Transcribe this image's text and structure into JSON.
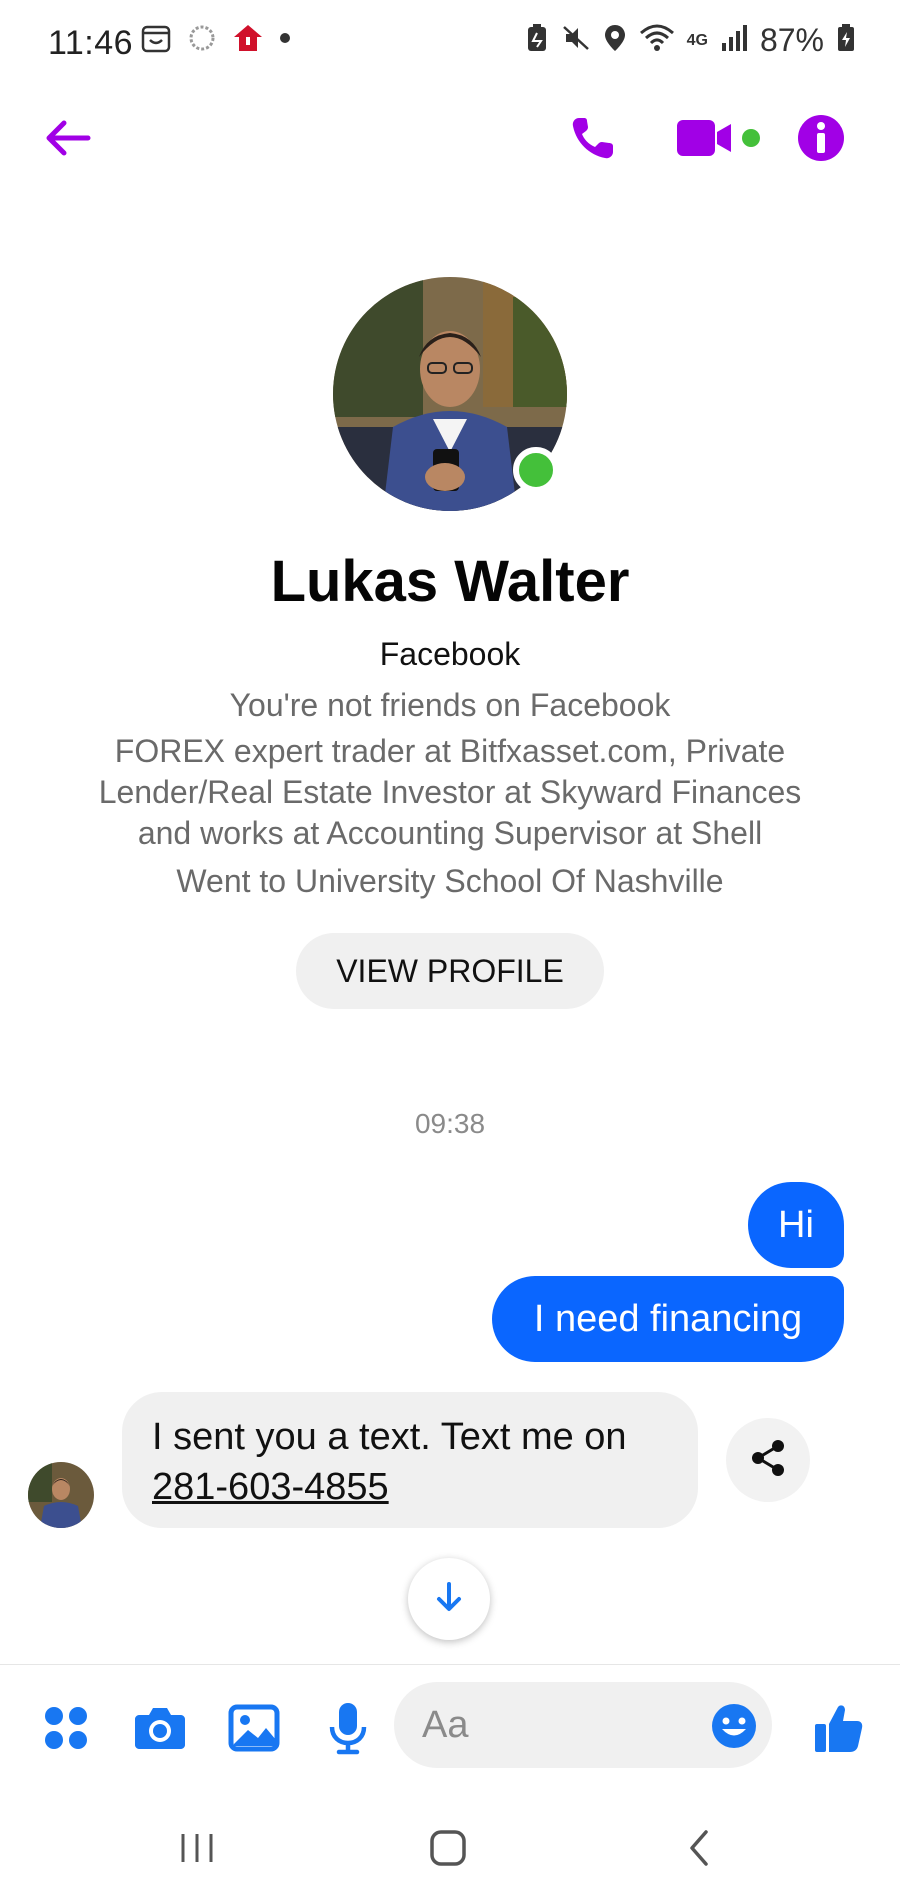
{
  "status_bar": {
    "time": "11:46",
    "battery": "87%",
    "network": "4G",
    "icons": [
      "calendar-icon",
      "sync-icon",
      "home-alert-icon",
      "dot-icon",
      "battery-saver-icon",
      "mute-vibrate-icon",
      "location-icon",
      "wifi-icon",
      "signal-icon",
      "battery-icon"
    ]
  },
  "header": {
    "icons": [
      "back-arrow-icon",
      "phone-call-icon",
      "video-call-icon",
      "info-icon"
    ],
    "accent_color": "#a100e6"
  },
  "profile": {
    "name": "Lukas Walter",
    "platform": "Facebook",
    "friend_status": "You're not friends on Facebook",
    "work_lines": [
      "FOREX expert trader at Bitfxasset.com, Private",
      "Lender/Real Estate Investor at Skyward Finances",
      "and works at Accounting Supervisor at Shell"
    ],
    "education": "Went to University School Of Nashville",
    "view_profile_label": "VIEW PROFILE",
    "online_color": "#44c03a"
  },
  "chat": {
    "timestamp": "09:38",
    "messages": [
      {
        "from": "me",
        "text": "Hi"
      },
      {
        "from": "me",
        "text": "I need financing"
      },
      {
        "from": "them",
        "text": "I sent you a text. Text me on",
        "phone": "281-603-4855"
      }
    ],
    "outgoing_color": "#0a66ff"
  },
  "composer": {
    "placeholder": "Aa",
    "icons": [
      "apps-grid-icon",
      "camera-icon",
      "gallery-icon",
      "microphone-icon",
      "emoji-icon",
      "thumbs-up-icon"
    ],
    "accent_color": "#1877f2"
  },
  "nav": {
    "icons": [
      "recent-apps-icon",
      "home-icon",
      "back-icon"
    ]
  }
}
